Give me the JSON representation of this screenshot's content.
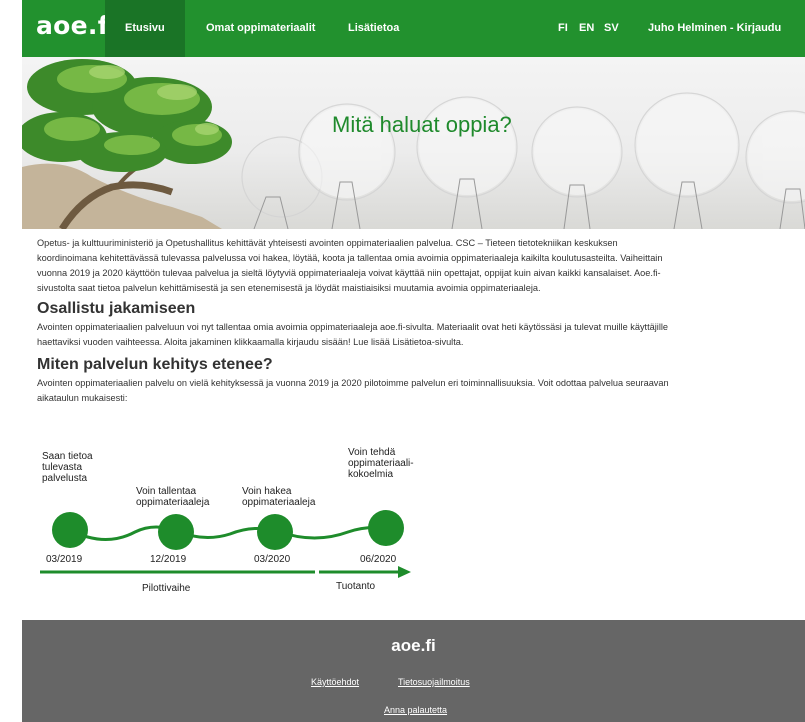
{
  "nav": {
    "logo": "aoe.fi",
    "items": [
      {
        "label": "Etusivu",
        "active": true
      },
      {
        "label": "Omat oppimateriaalit",
        "active": false
      },
      {
        "label": "Lisätietoa",
        "active": false
      }
    ],
    "languages": [
      "FI",
      "EN",
      "SV"
    ],
    "user": "Juho Helminen - Kirjaudu ulos"
  },
  "hero": {
    "title": "Mitä haluat oppia?"
  },
  "intro": {
    "lines": [
      "Opetus- ja kulttuuriministeriö ja Opetushallitus kehittävät yhteisesti avointen oppimateriaalien palvelua. CSC – Tieteen tietotekniikan keskuksen",
      "koordinoimana kehitettävässä tulevassa palvelussa voi hakea, löytää, koota ja tallentaa omia avoimia oppimateriaaleja kaikilta koulutusasteilta. Vaiheittain",
      "vuonna 2019 ja 2020 käyttöön tulevaa palvelua ja sieltä löytyviä oppimateriaaleja voivat käyttää niin opettajat, oppijat kuin aivan kaikki kansalaiset. Aoe.fi-",
      "sivustolta saat tietoa palvelun kehittämisestä ja sen etenemisestä ja löydät maistiaisiksi muutamia avoimia oppimateriaaleja."
    ]
  },
  "share": {
    "heading": "Osallistu jakamiseen",
    "lines": [
      "Avointen oppimateriaalien palveluun voi nyt tallentaa omia avoimia oppimateriaaleja aoe.fi-sivulta. Materiaalit ovat heti käytössäsi ja tulevat muille käyttäjille",
      "haettaviksi vuoden vaihteessa. Aloita jakaminen klikkaamalla kirjaudu sisään! Lue lisää Lisätietoa-sivulta."
    ]
  },
  "progress": {
    "heading": "Miten palvelun kehitys etenee?",
    "lines": [
      "Avointen oppimateriaalien palvelu on vielä kehityksessä ja vuonna 2019 ja 2020 pilotoimme palvelun eri toiminnallisuuksia. Voit odottaa palvelua seuraavan",
      "aikataulun mukaisesti:"
    ]
  },
  "timeline": {
    "milestones": [
      {
        "label": [
          "Saan tietoa",
          "tulevasta",
          "palvelusta"
        ],
        "date": "03/2019"
      },
      {
        "label": [
          "Voin tallentaa",
          "oppimateriaaleja"
        ],
        "date": "12/2019"
      },
      {
        "label": [
          "Voin hakea",
          "oppimateriaaleja"
        ],
        "date": "03/2020"
      },
      {
        "label": [
          "Voin tehdä",
          "oppimateriaali-",
          "kokoelmia"
        ],
        "date": "06/2020"
      }
    ],
    "phases": [
      "Pilottivaihe",
      "Tuotanto"
    ],
    "color": "#1e8c2b"
  },
  "footer": {
    "title": "aoe.fi",
    "links": [
      "Käyttöehdot",
      "Tietosuojailmoitus",
      "Anna palautetta"
    ]
  },
  "colors": {
    "brand": "#22912e",
    "brand_dark": "#1a7426",
    "footer": "#666666"
  }
}
